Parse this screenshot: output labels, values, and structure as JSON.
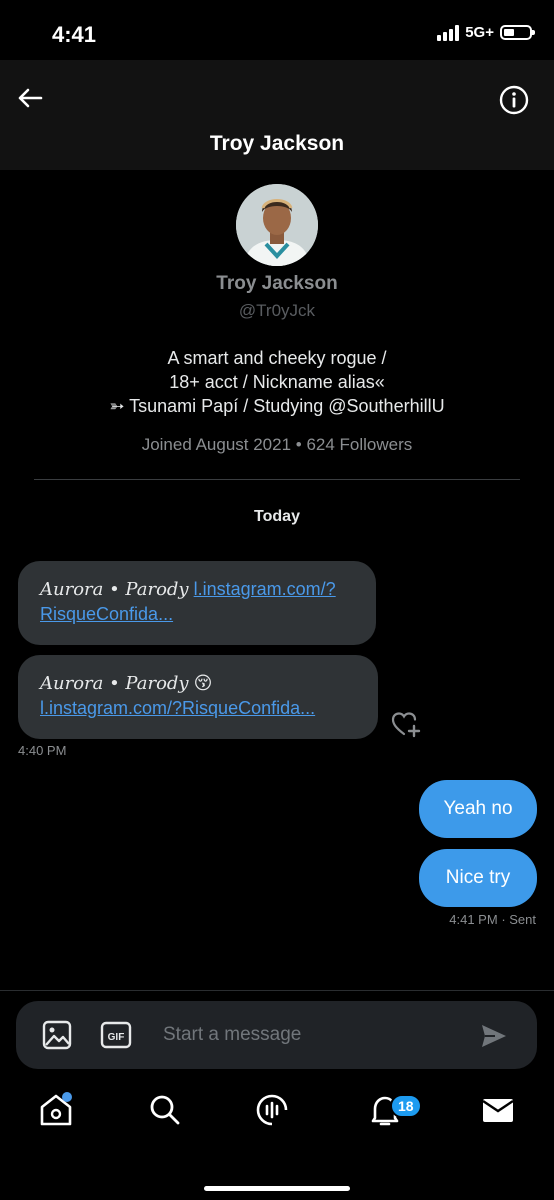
{
  "status_bar": {
    "time": "4:41",
    "network": "5G+"
  },
  "header": {
    "title": "Troy Jackson"
  },
  "profile": {
    "name": "Troy Jackson",
    "handle": "@Tr0yJck",
    "bio_line1": "A smart and cheeky rogue /",
    "bio_line2": "18+ acct / Nickname alias«",
    "bio_line3": "➳ Tsunami Papí / Studying @SoutherhillU",
    "joined": "Joined August 2021 • 624 Followers"
  },
  "conversation": {
    "date_label": "Today",
    "incoming": [
      {
        "sender": "Aurora • Parody",
        "emoji": "",
        "link_line1": "l.instagram.com/?",
        "link_line2": "RisqueConfida..."
      },
      {
        "sender": "Aurora • Parody",
        "emoji": "😚",
        "link": "l.instagram.com/?RisqueConfida..."
      }
    ],
    "incoming_time": "4:40 PM",
    "outgoing": [
      {
        "text": "Yeah no"
      },
      {
        "text": "Nice try"
      }
    ],
    "outgoing_time": "4:41 PM",
    "outgoing_status": "· Sent"
  },
  "composer": {
    "placeholder": "Start a message",
    "gif_label": "GIF"
  },
  "nav": {
    "notifications_count": "18"
  },
  "colors": {
    "accent": "#1d9bf0",
    "bubble_out": "#3d9aea",
    "bubble_in": "#2f3336",
    "link": "#4a99e9"
  },
  "icons": [
    "back-arrow-icon",
    "info-icon",
    "heart-plus-icon",
    "image-icon",
    "gif-icon",
    "send-icon",
    "home-icon",
    "search-icon",
    "spaces-icon",
    "bell-icon",
    "mail-icon"
  ]
}
